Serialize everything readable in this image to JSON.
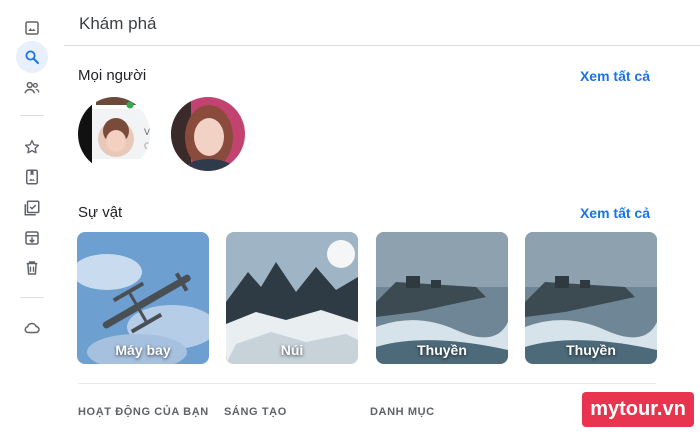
{
  "header": {
    "title": "Khám phá"
  },
  "people": {
    "title": "Mọi người",
    "see_all": "Xem tất cả",
    "card_text_1": "Vi",
    "card_text_2": "O"
  },
  "things": {
    "title": "Sự vật",
    "see_all": "Xem tất cả",
    "items": [
      {
        "label": "Máy bay"
      },
      {
        "label": "Núi"
      },
      {
        "label": "Thuyền"
      },
      {
        "label": "Thuyền"
      }
    ]
  },
  "categories": [
    "HOẠT ĐỘNG CỦA BẠN",
    "SÁNG TẠO",
    "DANH MỤC"
  ],
  "watermark": "mytour.vn",
  "colors": {
    "accent": "#1a73e8",
    "active_bg": "#e8f0fe",
    "watermark": "#e8344e"
  }
}
